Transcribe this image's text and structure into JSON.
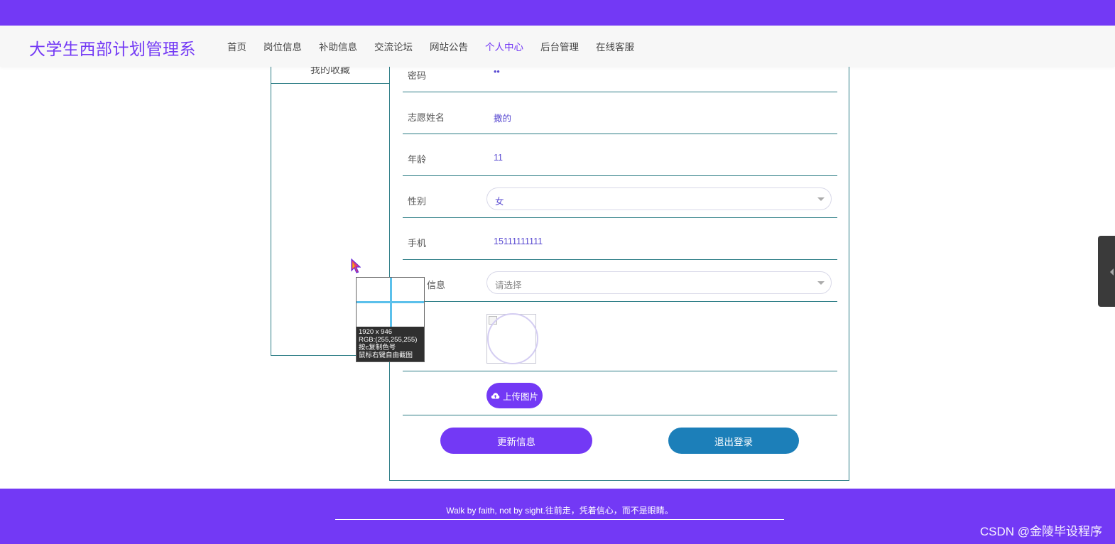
{
  "header": {
    "brand": "大学生西部计划管理系",
    "nav": [
      {
        "label": "首页",
        "active": false
      },
      {
        "label": "岗位信息",
        "active": false
      },
      {
        "label": "补助信息",
        "active": false
      },
      {
        "label": "交流论坛",
        "active": false
      },
      {
        "label": "网站公告",
        "active": false
      },
      {
        "label": "个人中心",
        "active": true
      },
      {
        "label": "后台管理",
        "active": false
      },
      {
        "label": "在线客服",
        "active": false
      }
    ]
  },
  "sidebar": {
    "items": [
      {
        "label": "我的收藏"
      }
    ]
  },
  "form": {
    "password": {
      "label": "密码",
      "value": "••"
    },
    "name": {
      "label": "志愿姓名",
      "value": "撒的"
    },
    "age": {
      "label": "年龄",
      "value": "11"
    },
    "gender": {
      "label": "性别",
      "value": "女"
    },
    "phone": {
      "label": "手机",
      "value": "15111111111"
    },
    "post_info": {
      "label": "信息",
      "placeholder": "请选择"
    },
    "upload_label": "上传图片",
    "update_button": "更新信息",
    "logout_button": "退出登录"
  },
  "color_picker": {
    "size": "1920 x 946",
    "rgb": "RGB:(255,255,255)",
    "hint_copy": "按c复制色号",
    "hint_capture": "鼠标右键自由截图"
  },
  "footer": {
    "quote": "Walk by faith, not by sight.往前走，凭着信心，而不是眼睛。",
    "watermark": "CSDN @金陵毕设程序"
  },
  "colors": {
    "accent": "#7339f5",
    "logout": "#1c7fb9",
    "border": "#2b7c85"
  },
  "icons": {
    "upload": "cloud-upload-icon",
    "cursor": "mouse-pointer-icon"
  }
}
